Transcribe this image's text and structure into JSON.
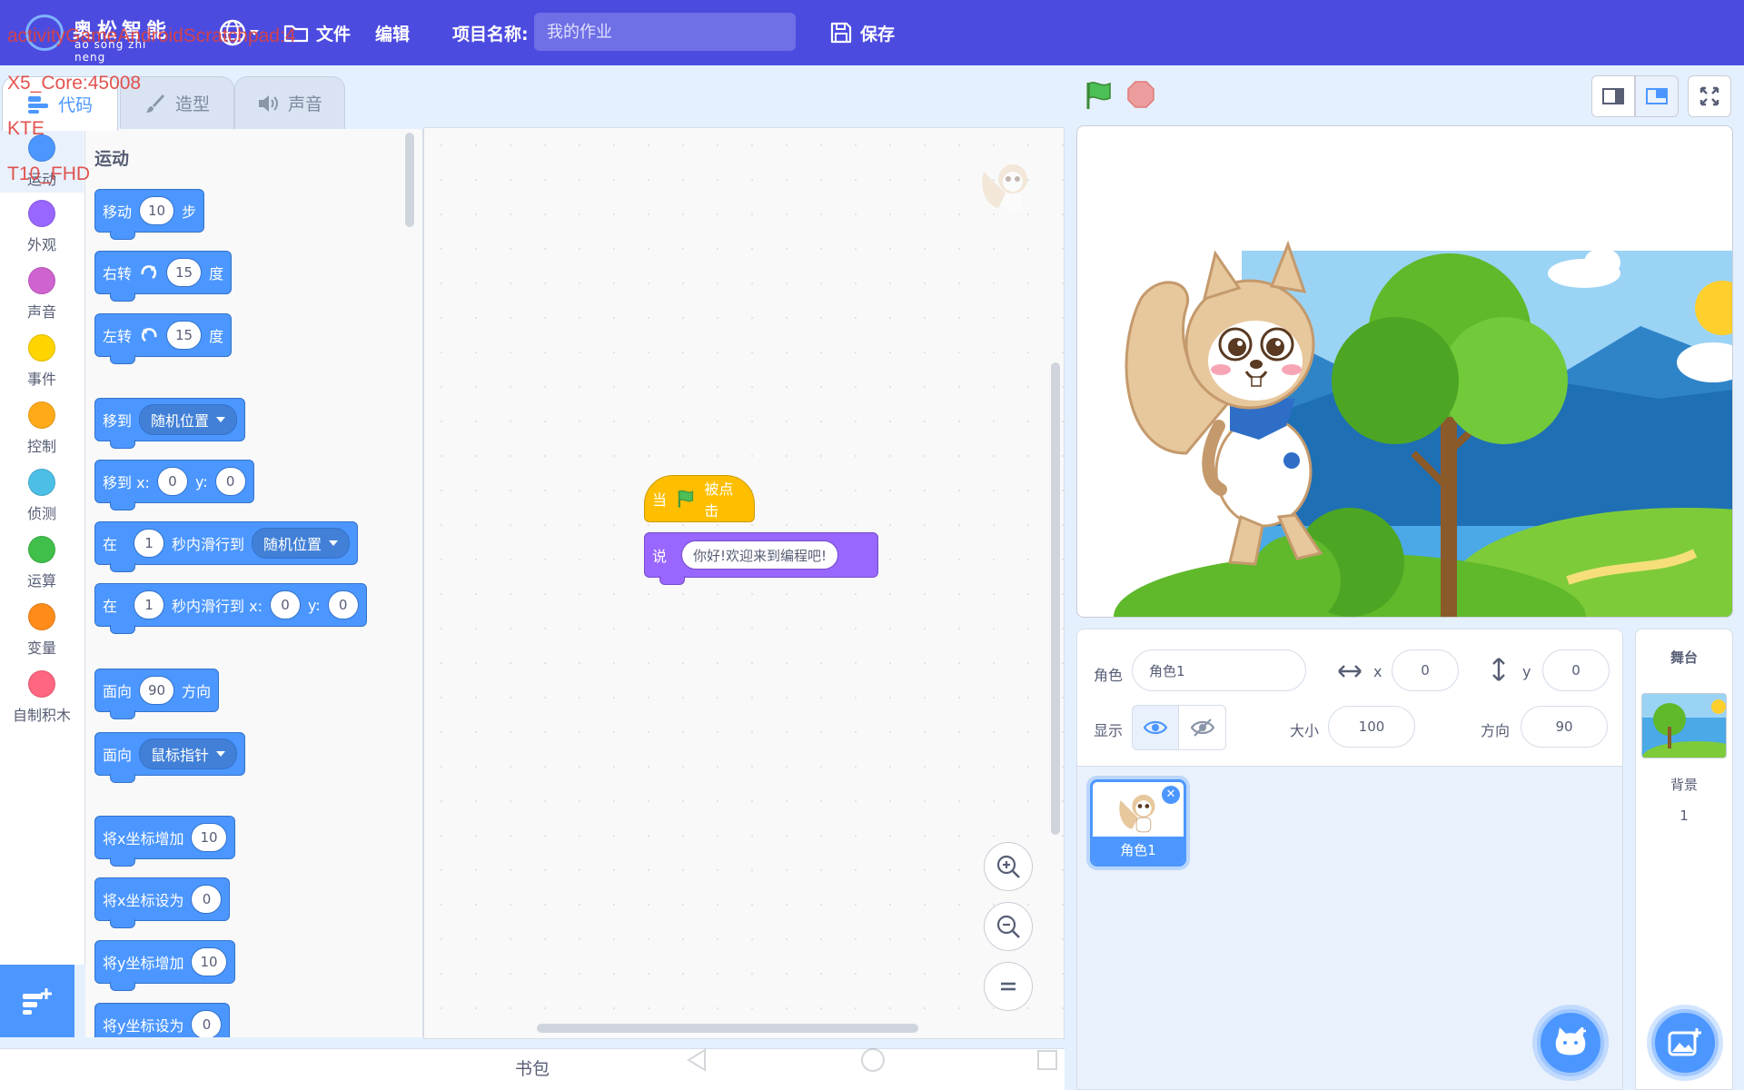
{
  "menubar": {
    "logo_title": "奥松智能",
    "logo_sub": "ao song zhi neng",
    "file": "文件",
    "edit": "编辑",
    "project_label": "项目名称:",
    "project_placeholder": "我的作业",
    "save": "保存"
  },
  "debug": {
    "line1": "activityGameAndroidScratchpad:4",
    "line2": "X5_Core:45008",
    "line3": "KTE",
    "line4": "T10_FHD"
  },
  "tabs": {
    "code": "代码",
    "costume": "造型",
    "sound": "声音"
  },
  "categories": [
    {
      "label": "运动",
      "color": "#4c97ff"
    },
    {
      "label": "外观",
      "color": "#9966ff"
    },
    {
      "label": "声音",
      "color": "#cf63cf"
    },
    {
      "label": "事件",
      "color": "#ffd500"
    },
    {
      "label": "控制",
      "color": "#ffab19"
    },
    {
      "label": "侦测",
      "color": "#4cbfe6"
    },
    {
      "label": "运算",
      "color": "#40bf4a"
    },
    {
      "label": "变量",
      "color": "#ff8c1a"
    },
    {
      "label": "自制积木",
      "color": "#ff6680"
    }
  ],
  "palette": {
    "heading": "运动",
    "move": {
      "a": "移动",
      "n": "10",
      "b": "步"
    },
    "turn_right": {
      "a": "右转",
      "n": "15",
      "b": "度"
    },
    "turn_left": {
      "a": "左转",
      "n": "15",
      "b": "度"
    },
    "goto": {
      "a": "移到",
      "drop": "随机位置"
    },
    "goto_xy": {
      "a": "移到 x:",
      "x": "0",
      "ylab": "y:",
      "y": "0"
    },
    "glide": {
      "a": "在",
      "n": "1",
      "b": "秒内滑行到",
      "drop": "随机位置"
    },
    "glide_xy": {
      "a": "在",
      "n": "1",
      "b": "秒内滑行到 x:",
      "x": "0",
      "ylab": "y:",
      "y": "0"
    },
    "point_dir": {
      "a": "面向",
      "n": "90",
      "b": "方向"
    },
    "point_towards": {
      "a": "面向",
      "drop": "鼠标指针"
    },
    "change_x": {
      "a": "将x坐标增加",
      "n": "10"
    },
    "set_x": {
      "a": "将x坐标设为",
      "n": "0"
    },
    "change_y": {
      "a": "将y坐标增加",
      "n": "10"
    },
    "set_y": {
      "a": "将y坐标设为",
      "n": "0"
    }
  },
  "script": {
    "hat_a": "当",
    "hat_b": "被点击",
    "say_label": "说",
    "say_text": "你好!欢迎来到编程吧!"
  },
  "backpack": "书包",
  "sprite_info": {
    "sprite_label": "角色",
    "sprite_name": "角色1",
    "x_label": "x",
    "x": "0",
    "y_label": "y",
    "y": "0",
    "show_label": "显示",
    "size_label": "大小",
    "size": "100",
    "direction_label": "方向",
    "direction": "90"
  },
  "sprites": [
    {
      "name": "角色1"
    }
  ],
  "stage_panel": {
    "title": "舞台",
    "backdrop_label": "背景",
    "backdrop_count": "1"
  },
  "icons": {
    "logo": "logo-mark",
    "language": "globe-icon",
    "file": "folder-icon",
    "save": "save-icon",
    "green_flag": "green-flag-icon",
    "stop": "stop-icon",
    "zoom_in": "zoom-in-icon",
    "zoom_out": "zoom-out-icon",
    "zoom_reset": "zoom-reset-icon",
    "extension": "extension-icon",
    "add_sprite": "cat-plus-icon",
    "add_backdrop": "image-plus-icon"
  },
  "colors": {
    "menubar": "#4c4be0",
    "motion": "#4c97ff",
    "looks": "#9966ff",
    "events": "#ffbf00",
    "accent": "#4c97ff"
  }
}
